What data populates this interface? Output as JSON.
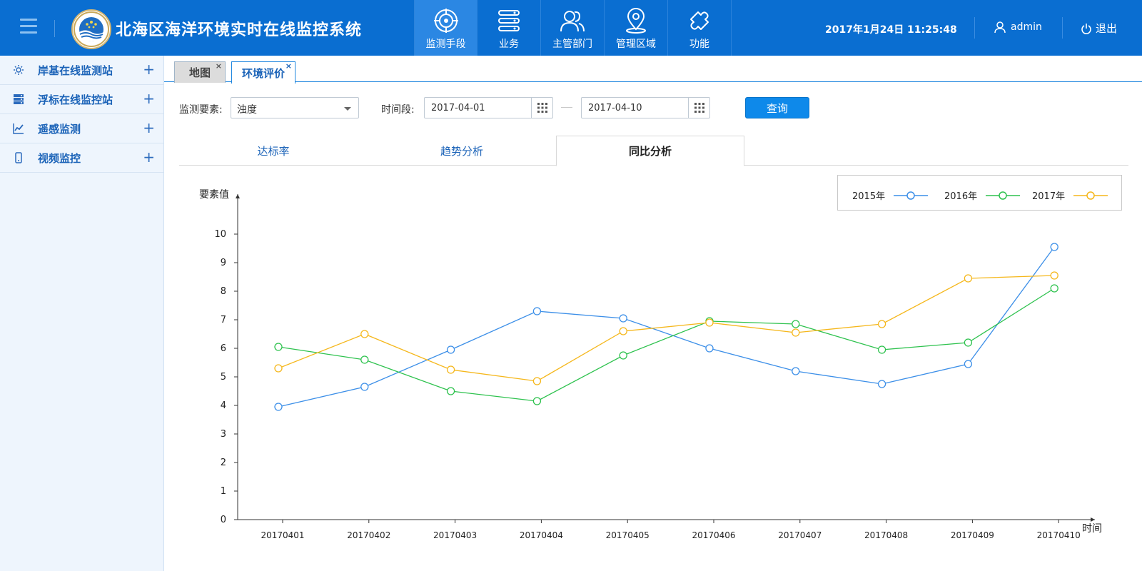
{
  "header": {
    "app_title": "北海区海洋环境实时在线监控系统",
    "nav": [
      {
        "label": "监测手段",
        "icon": "target-icon",
        "active": true
      },
      {
        "label": "业务",
        "icon": "server-icon",
        "active": false
      },
      {
        "label": "主管部门",
        "icon": "users-icon",
        "active": false
      },
      {
        "label": "管理区域",
        "icon": "location-pin-icon",
        "active": false
      },
      {
        "label": "功能",
        "icon": "puzzle-icon",
        "active": false
      }
    ],
    "datetime": "2017年1月24日  11:25:48",
    "user": "admin",
    "logout": "退出"
  },
  "sidebar": {
    "items": [
      {
        "label": "岸基在线监测站",
        "icon": "gear-icon"
      },
      {
        "label": "浮标在线监控站",
        "icon": "server-stack-icon"
      },
      {
        "label": "遥感监测",
        "icon": "line-chart-icon"
      },
      {
        "label": "视频监控",
        "icon": "phone-icon"
      }
    ],
    "expand_symbol": "+"
  },
  "tabs": {
    "items": [
      {
        "label": "地图",
        "active": false
      },
      {
        "label": "环境评价",
        "active": true
      }
    ],
    "close_symbol": "×"
  },
  "query": {
    "element_label": "监测要素:",
    "element_value": "浊度",
    "period_label": "时间段:",
    "start_date": "2017-04-01",
    "end_date": "2017-04-10",
    "button": "查询"
  },
  "subtabs": [
    {
      "label": "达标率",
      "active": false
    },
    {
      "label": "趋势分析",
      "active": false
    },
    {
      "label": "同比分析",
      "active": true
    }
  ],
  "chart_data": {
    "type": "line",
    "ylabel": "要素值",
    "xlabel": "时间",
    "ylim": [
      0,
      10
    ],
    "y_ticks": [
      0,
      1,
      2,
      3,
      4,
      5,
      6,
      7,
      8,
      9,
      10
    ],
    "categories": [
      "20170401",
      "20170402",
      "20170403",
      "20170404",
      "20170405",
      "20170406",
      "20170407",
      "20170408",
      "20170409",
      "20170410"
    ],
    "series": [
      {
        "name": "2015年",
        "color": "#3c8fe8",
        "values": [
          3.95,
          4.65,
          5.95,
          7.3,
          7.05,
          6.0,
          5.2,
          4.75,
          5.45,
          9.55
        ]
      },
      {
        "name": "2016年",
        "color": "#2ec24e",
        "values": [
          6.05,
          5.6,
          4.5,
          4.15,
          5.75,
          6.95,
          6.85,
          5.95,
          6.2,
          8.1
        ]
      },
      {
        "name": "2017年",
        "color": "#f5b71b",
        "values": [
          5.3,
          6.5,
          5.25,
          4.85,
          6.6,
          6.9,
          6.55,
          6.85,
          8.45,
          8.55
        ]
      }
    ],
    "legend_position": "top-right",
    "grid": false
  }
}
